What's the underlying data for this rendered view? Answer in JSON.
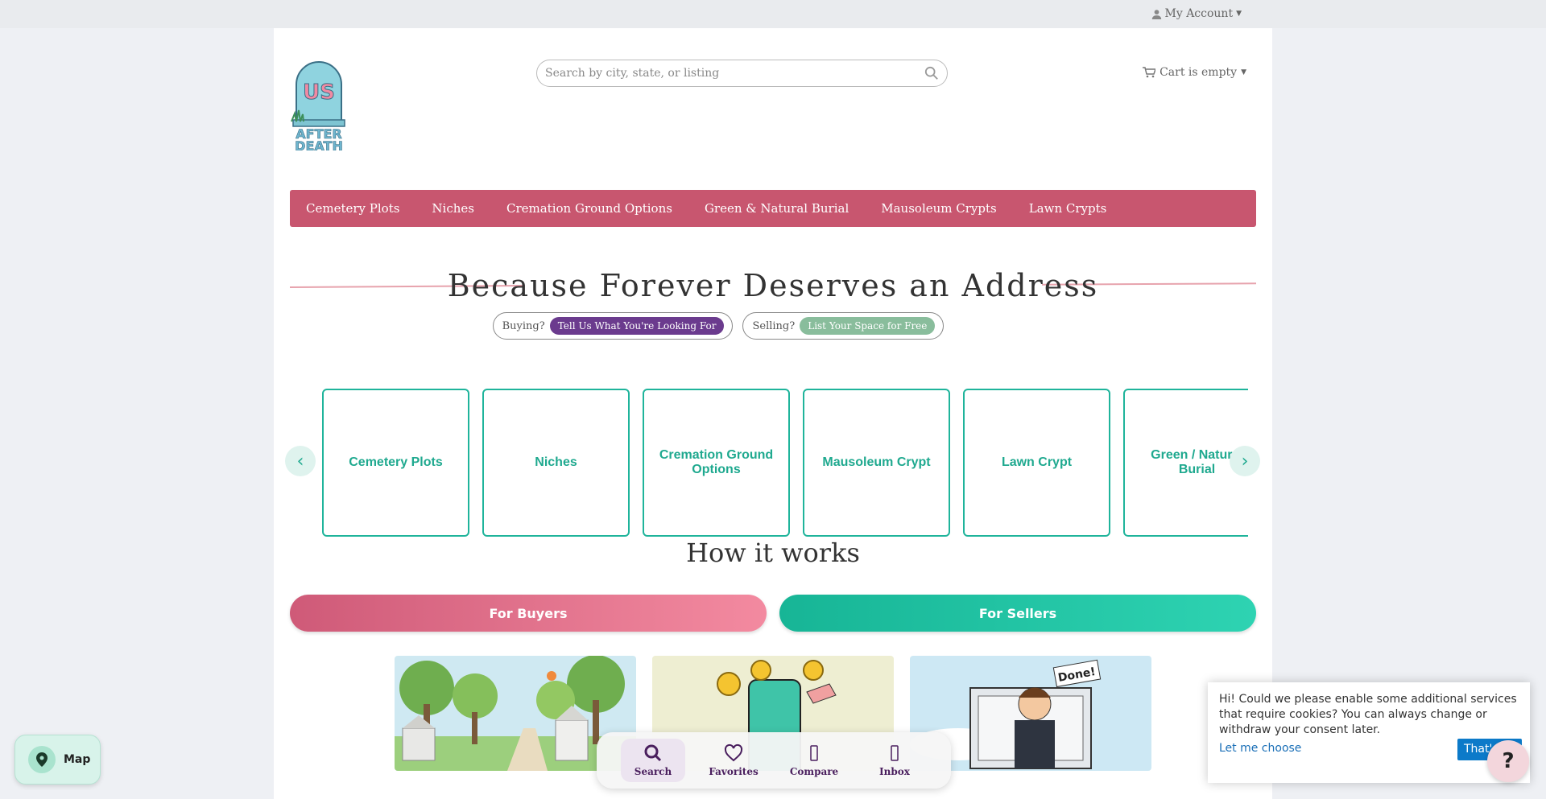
{
  "header": {
    "account_label": "My Account",
    "search_placeholder": "Search by city, state, or listing",
    "cart_label": "Cart is empty",
    "logo": {
      "top": "US",
      "bottom_line1": "AFTER",
      "bottom_line2": "DEATH"
    }
  },
  "nav": {
    "items": [
      {
        "label": "Cemetery Plots"
      },
      {
        "label": "Niches"
      },
      {
        "label": "Cremation Ground Options"
      },
      {
        "label": "Green & Natural Burial"
      },
      {
        "label": "Mausoleum Crypts"
      },
      {
        "label": "Lawn Crypts"
      }
    ]
  },
  "hero": {
    "title": "Because Forever Deserves an Address"
  },
  "pills": {
    "buying_label": "Buying?",
    "buying_cta": "Tell Us What You're Looking For",
    "selling_label": "Selling?",
    "selling_cta": "List Your Space for Free"
  },
  "categories": {
    "prev_label": "‹",
    "next_label": "›",
    "items": [
      {
        "label": "Cemetery Plots"
      },
      {
        "label": "Niches"
      },
      {
        "label": "Cremation Ground Options"
      },
      {
        "label": "Mausoleum Crypt"
      },
      {
        "label": "Lawn Crypt"
      },
      {
        "label": "Green / Natural Burial"
      }
    ]
  },
  "how_it_works": {
    "title": "How it works",
    "buyers_label": "For Buyers",
    "sellers_label": "For Sellers",
    "illustration_3_sign": "Done!"
  },
  "map_button": {
    "label": "Map"
  },
  "bottom_nav": {
    "items": [
      {
        "label": "Search",
        "icon": "search-icon"
      },
      {
        "label": "Favorites",
        "icon": "heart-icon"
      },
      {
        "label": "Compare",
        "icon": "compare-icon"
      },
      {
        "label": "Inbox",
        "icon": "inbox-icon"
      }
    ]
  },
  "cookie": {
    "message": "Hi! Could we please enable some additional services that require cookies? You can always change or withdraw your consent later.",
    "choose_label": "Let me choose",
    "accept_label": "That's ok"
  },
  "help": {
    "label": "?"
  },
  "colors": {
    "nav_bg": "#c8566f",
    "teal": "#1fb49b",
    "purple": "#6b3b8e",
    "sage": "#89bd9c"
  }
}
